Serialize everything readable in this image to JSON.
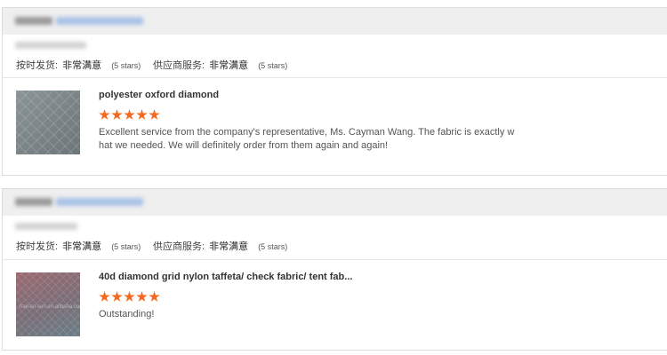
{
  "colors": {
    "star": "#f6681e",
    "header_bg": "#efefef",
    "border": "#dcdcdc"
  },
  "rating_labels": {
    "on_time_delivery": "按时发货:",
    "supplier_service": "供应商服务:"
  },
  "reviews": [
    {
      "on_time_delivery_value": "非常满意",
      "on_time_delivery_stars": "(5 stars)",
      "supplier_service_value": "非常满意",
      "supplier_service_stars": "(5 stars)",
      "product_title": "polyester oxford diamond",
      "rating": 5,
      "review_text": "Excellent service from the company's representative, Ms. Cayman Wang. The fabric is exactly what we needed. We will definitely order from them again and again!",
      "thumb_icon": "fabric-thumbnail"
    },
    {
      "on_time_delivery_value": "非常满意",
      "on_time_delivery_stars": "(5 stars)",
      "supplier_service_value": "非常满意",
      "supplier_service_stars": "(5 stars)",
      "product_title": "40d diamond grid nylon taffeta/ check fabric/ tent fab...",
      "rating": 5,
      "review_text": "Outstanding!",
      "thumb_icon": "fabric-thumbnail"
    }
  ]
}
